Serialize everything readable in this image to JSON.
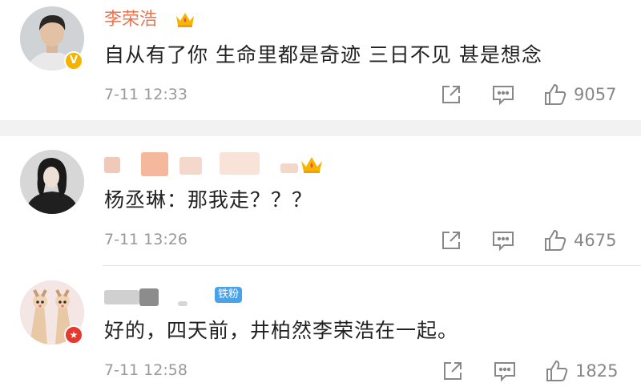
{
  "comments": [
    {
      "username": "李荣浩",
      "text": "自从有了你 生命里都是奇迹 三日不见 甚是想念",
      "time": "7-11 12:33",
      "likes": "9057",
      "badge": "V"
    },
    {
      "username": "",
      "text": "杨丞琳：那我走？？？",
      "time": "7-11 13:26",
      "likes": "4675"
    },
    {
      "username": "",
      "fan_badge": "铁粉",
      "text": "好的，四天前，井柏然李荣浩在一起。",
      "time": "7-11 12:58",
      "likes": "1825"
    }
  ],
  "icons": [
    "share-icon",
    "comment-icon",
    "like-icon",
    "crown-icon",
    "verified-icon"
  ],
  "colors": {
    "name": "#eb7350",
    "text": "#222222",
    "meta": "#999999",
    "separator": "#f2f2f2",
    "fan_badge": "#4aa3e8"
  }
}
